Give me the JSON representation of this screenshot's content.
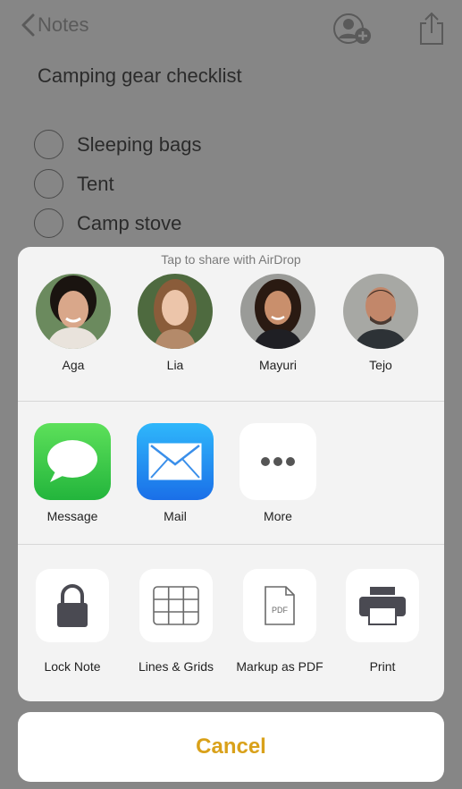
{
  "nav": {
    "back_label": "Notes",
    "icons": [
      "chevron-left-icon",
      "add-person-icon",
      "share-icon"
    ]
  },
  "note": {
    "title": "Camping gear checklist",
    "items": [
      {
        "text": "Sleeping bags",
        "checked": false
      },
      {
        "text": "Tent",
        "checked": false
      },
      {
        "text": "Camp stove",
        "checked": false
      }
    ]
  },
  "share_sheet": {
    "airdrop_title": "Tap to share with AirDrop",
    "people": [
      {
        "name": "Aga"
      },
      {
        "name": "Lia"
      },
      {
        "name": "Mayuri"
      },
      {
        "name": "Tejo"
      }
    ],
    "apps": [
      {
        "label": "Message",
        "icon": "message-icon"
      },
      {
        "label": "Mail",
        "icon": "mail-icon"
      },
      {
        "label": "More",
        "icon": "more-icon"
      }
    ],
    "actions": [
      {
        "label": "Lock Note",
        "icon": "lock-icon"
      },
      {
        "label": "Lines & Grids",
        "icon": "grid-icon"
      },
      {
        "label": "Markup as PDF",
        "icon": "pdf-icon",
        "icon_text": "PDF"
      },
      {
        "label": "Print",
        "icon": "printer-icon"
      }
    ]
  },
  "cancel_label": "Cancel",
  "colors": {
    "accent": "#d9a11a",
    "message_green": "#3cc84a",
    "mail_blue": "#1e8ef0",
    "dim_overlay": "#868686"
  }
}
